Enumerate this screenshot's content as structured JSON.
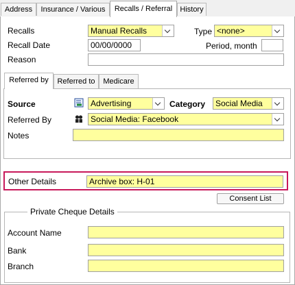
{
  "tabs": [
    {
      "label": "Address"
    },
    {
      "label": "Insurance / Various"
    },
    {
      "label": "Recalls / Referral"
    },
    {
      "label": "History"
    }
  ],
  "recalls": {
    "recalls_label": "Recalls",
    "recalls_value": "Manual Recalls",
    "type_label": "Type",
    "type_value": "<none>",
    "recall_date_label": "Recall Date",
    "recall_date_value": "00/00/0000",
    "period_label": "Period, month",
    "period_value": "",
    "reason_label": "Reason",
    "reason_value": ""
  },
  "subtabs": [
    {
      "label": "Referred by"
    },
    {
      "label": "Referred to"
    },
    {
      "label": "Medicare"
    }
  ],
  "referred_by": {
    "source_label": "Source",
    "source_value": "Advertising",
    "category_label": "Category",
    "category_value": "Social Media",
    "referred_by_label": "Referred By",
    "referred_by_value": "Social Media: Facebook",
    "notes_label": "Notes",
    "notes_value": ""
  },
  "other_details": {
    "label": "Other Details",
    "value": "Archive box: H-01"
  },
  "consent_button": "Consent List",
  "private_cheque": {
    "title": "Private Cheque Details",
    "account_name_label": "Account Name",
    "account_name_value": "",
    "bank_label": "Bank",
    "bank_value": "",
    "branch_label": "Branch",
    "branch_value": ""
  },
  "colors": {
    "field_yellow": "#ffff9e",
    "highlight_border": "#c8185a"
  },
  "icons": {
    "source_icon": "edit-list-icon",
    "referred_by_icon": "people-search-icon"
  }
}
